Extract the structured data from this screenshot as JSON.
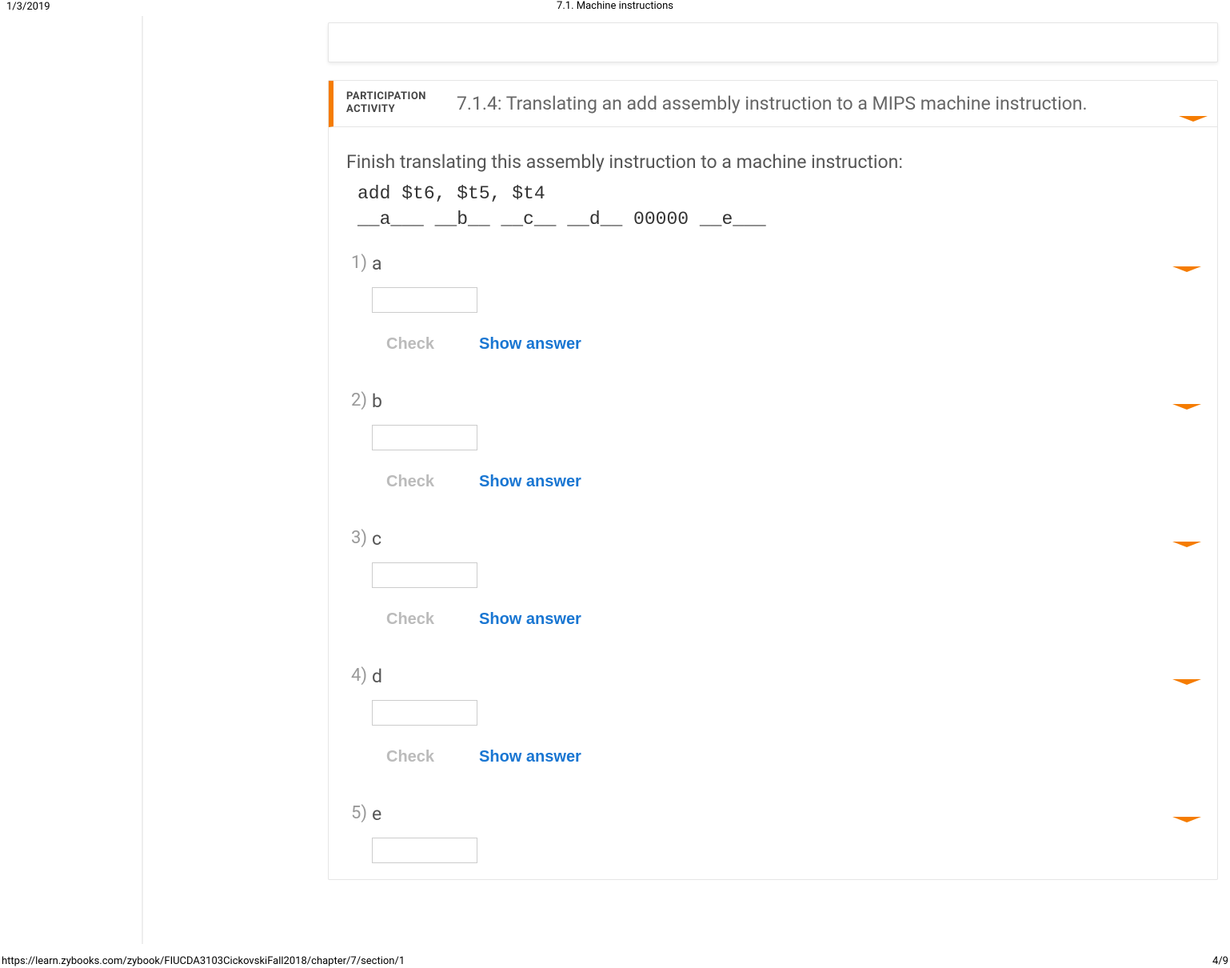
{
  "print": {
    "date": "1/3/2019",
    "title": "7.1. Machine instructions",
    "url": "https://learn.zybooks.com/zybook/FIUCDA3103CickovskiFall2018/chapter/7/section/1",
    "page": "4/9"
  },
  "activity": {
    "label_line1": "PARTICIPATION",
    "label_line2": "ACTIVITY",
    "title": "7.1.4: Translating an add assembly instruction to a MIPS machine instruction."
  },
  "body": {
    "instructions": "Finish translating this assembly instruction to a machine instruction:",
    "code_line1": "add $t6, $t5, $t4",
    "code_line2": "__a___  __b__  __c__  __d__ 00000 __e___"
  },
  "actions": {
    "check": "Check",
    "show_answer": "Show answer"
  },
  "questions": [
    {
      "num": "1)",
      "label": "a"
    },
    {
      "num": "2)",
      "label": "b"
    },
    {
      "num": "3)",
      "label": "c"
    },
    {
      "num": "4)",
      "label": "d"
    },
    {
      "num": "5)",
      "label": "e"
    }
  ]
}
